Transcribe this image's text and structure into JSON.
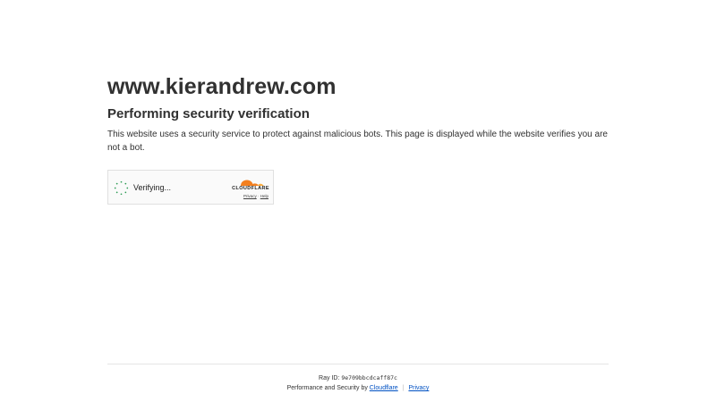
{
  "site": {
    "domain": "www.kierandrew.com",
    "heading": "Performing security verification",
    "description": "This website uses a security service to protect against malicious bots. This page is displayed while the website verifies you are not a bot."
  },
  "widget": {
    "status_text": "Verifying...",
    "spinner_icon": "loading-spinner-icon",
    "brand_icon": "cloudflare-cloud-icon",
    "brand_name": "CLOUDFLARE",
    "privacy_link": "Privacy",
    "link_separator": "·",
    "help_link": "Help",
    "brand_color": "#f38020"
  },
  "footer": {
    "ray_label": "Ray ID:",
    "ray_id": "9e709bbcdcaff87c",
    "credit_text": "Performance and Security by",
    "cloudflare_link": "Cloudflare",
    "separator": "|",
    "privacy_link": "Privacy",
    "link_color": "#0051c3"
  }
}
